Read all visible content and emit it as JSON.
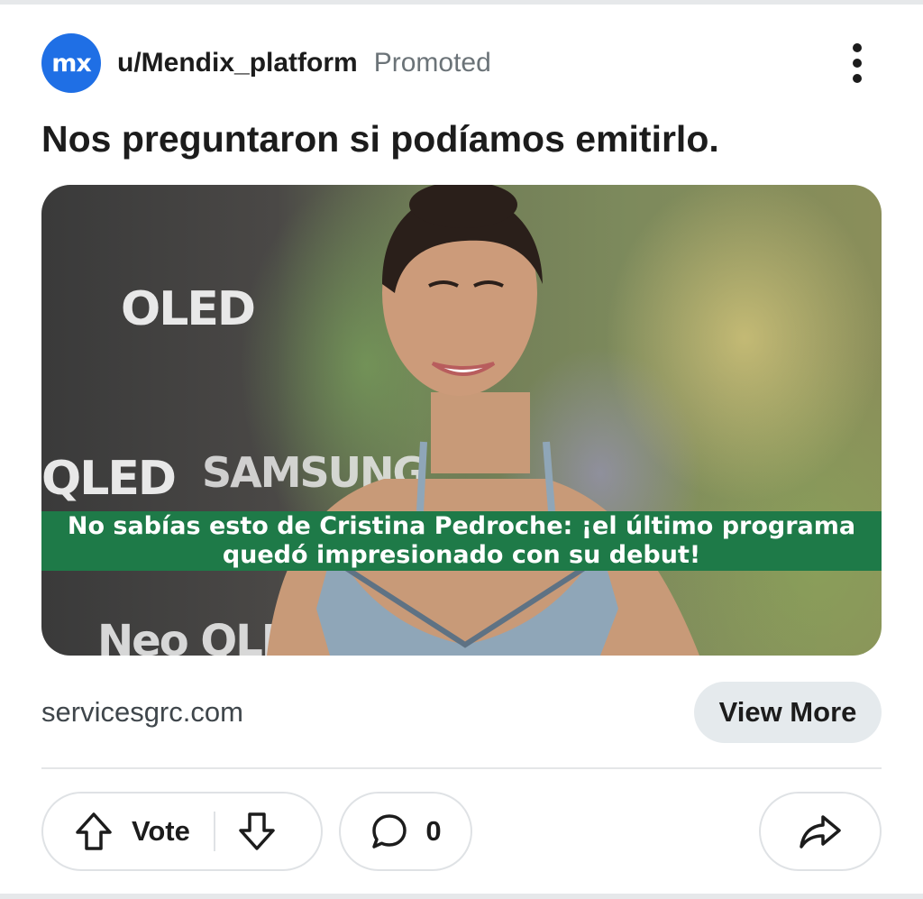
{
  "post": {
    "avatar_text": "mx",
    "username": "u/Mendix_platform",
    "promoted_label": "Promoted",
    "title": "Nos preguntaron si podíamos emitirlo.",
    "media": {
      "banner_line1": "No sabías esto de Cristina Pedroche: ¡el último programa",
      "banner_line2": "quedó impresionado con su debut!",
      "backdrop_texts": [
        "OLED",
        "QLED",
        "SAMSUNG",
        "Neo QLED"
      ]
    },
    "domain": "servicesgrc.com",
    "cta_label": "View More"
  },
  "actions": {
    "vote_label": "Vote",
    "comment_count": "0"
  },
  "icons": {
    "avatar": "mendix-logo-icon",
    "more": "more-vertical-icon",
    "upvote": "upvote-arrow-icon",
    "downvote": "downvote-arrow-icon",
    "comment": "comment-bubble-icon",
    "share": "share-arrow-icon"
  },
  "colors": {
    "avatar_bg": "#1f6fe5",
    "banner_bg": "#1e7a48",
    "cta_bg": "#e5eaed",
    "promoted_text": "#6b7378"
  }
}
